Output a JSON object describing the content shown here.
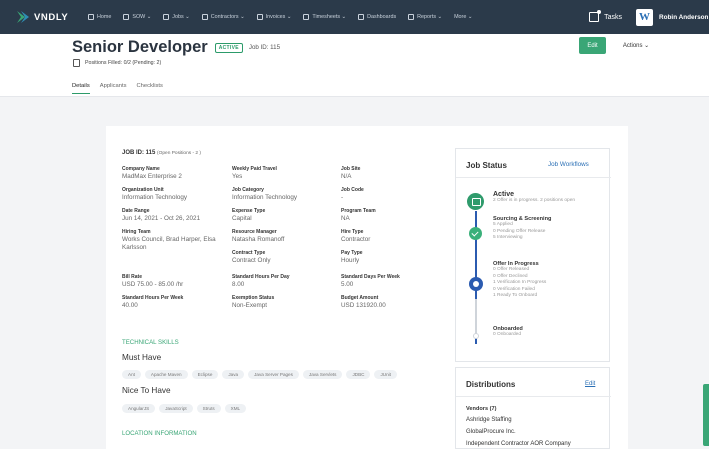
{
  "brand": {
    "name": "VNDLY"
  },
  "nav": {
    "items": [
      "Home",
      "SOW",
      "Jobs",
      "Contractors",
      "Invoices",
      "Timesheets",
      "Dashboards",
      "Reports",
      "More"
    ],
    "tasks_label": "Tasks",
    "avatar_letter": "W",
    "user_name": "Robin Anderson"
  },
  "header": {
    "title": "Senior Developer",
    "status": "ACTIVE",
    "job_id": "Job ID: 115",
    "positions_filled": "Positions Filled: 0/2 (Pending: 2)",
    "edit_label": "Edit",
    "actions_label": "Actions ⌄",
    "tabs": [
      "Details",
      "Applicants",
      "Checklists"
    ]
  },
  "details": {
    "job_id_line": "JOB ID: 115",
    "open_positions": "(Open Positions - 2 )",
    "fields": [
      {
        "label": "Company Name",
        "value": "MadMax Enterprise 2"
      },
      {
        "label": "Weekly Paid Travel",
        "value": "Yes"
      },
      {
        "label": "Job Site",
        "value": "N/A"
      },
      {
        "label": "Organization Unit",
        "value": "Information Technology"
      },
      {
        "label": "Job Category",
        "value": "Information Technology"
      },
      {
        "label": "Job Code",
        "value": "-"
      },
      {
        "label": "Date Range",
        "value": "Jun 14, 2021 - Oct 26, 2021"
      },
      {
        "label": "Expense Type",
        "value": "Capital"
      },
      {
        "label": "Program Team",
        "value": "NA"
      },
      {
        "label": "Hiring Team",
        "value": "Works Council, Brad Harper, Elsa Karlsson"
      },
      {
        "label": "Resource Manager",
        "value": "Natasha Romanoff"
      },
      {
        "label": "Hire Type",
        "value": "Contractor"
      },
      {
        "label": "Contract Type",
        "value": "Contract Only"
      },
      {
        "label": "Pay Type",
        "value": "Hourly"
      },
      {
        "label": "Bill Rate",
        "value": "USD 75.00 - 85.00 /hr"
      },
      {
        "label": "Standard Hours Per Day",
        "value": "8.00"
      },
      {
        "label": "Standard Days Per Week",
        "value": "5.00"
      },
      {
        "label": "Standard Hours Per Week",
        "value": "40.00"
      },
      {
        "label": "Exemption Status",
        "value": "Non-Exempt"
      },
      {
        "label": "Budget Amount",
        "value": "USD 131920.00"
      }
    ],
    "technical_skills_heading": "TECHNICAL SKILLS",
    "must_have_label": "Must Have",
    "must_have": [
      "Ant",
      "Apache Maven",
      "Eclipse",
      "Java",
      "Java Server Pages",
      "Java Servlets",
      "JDBC",
      "JUnit"
    ],
    "nice_to_have_label": "Nice To Have",
    "nice_to_have": [
      "AngularJS",
      "JavaScript",
      "Struts",
      "XML"
    ],
    "location_heading": "LOCATION INFORMATION"
  },
  "job_status": {
    "title": "Job Status",
    "workflows_link": "Job Workflows",
    "stages": [
      {
        "name": "Active",
        "lines": [
          "2 Offer is in progress. 2 positions open"
        ]
      },
      {
        "name": "Sourcing & Screening",
        "lines": [
          "5 Applied",
          "0 Pending Offer Release",
          "5 Interviewing"
        ]
      },
      {
        "name": "Offer In Progress",
        "lines": [
          "0 Offer Released",
          "0 Offer Declined",
          "1 Verification In Progress",
          "0 Verification Failed",
          "1 Ready To Onboard"
        ]
      },
      {
        "name": "Onboarded",
        "lines": [
          "0 Onboarded"
        ]
      }
    ]
  },
  "distributions": {
    "title": "Distributions",
    "edit_label": "Edit",
    "vendors_label": "Vendors (7)",
    "vendors": [
      "Ashridge Staffing",
      "GlobalProcure Inc.",
      "Independent Contractor AOR Company"
    ]
  },
  "colors": {
    "nav_bg": "#2b3a4a",
    "accent_green": "#3aa676",
    "link_blue": "#2a6fb5",
    "timeline_blue": "#2b5bb0"
  }
}
